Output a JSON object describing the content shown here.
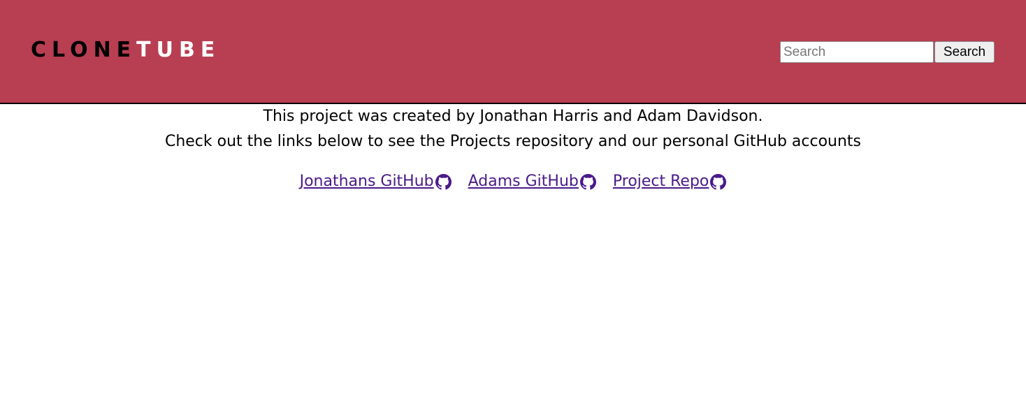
{
  "header": {
    "logo_part1": "CLONE",
    "logo_part2": "TUBE",
    "search_placeholder": "Search",
    "search_value": "",
    "search_button_label": "Search",
    "background_color": "#b83e52"
  },
  "main": {
    "line1": "This project was created by Jonathan Harris and Adam Davidson.",
    "line2": "Check out the links below to see the Projects repository and our personal GitHub accounts",
    "links": [
      {
        "label": "Jonathans GitHub ",
        "icon": "github-icon"
      },
      {
        "label": "Adams GitHub ",
        "icon": "github-icon"
      },
      {
        "label": "Project Repo ",
        "icon": "github-icon"
      }
    ],
    "link_color": "#4a1a8a"
  }
}
